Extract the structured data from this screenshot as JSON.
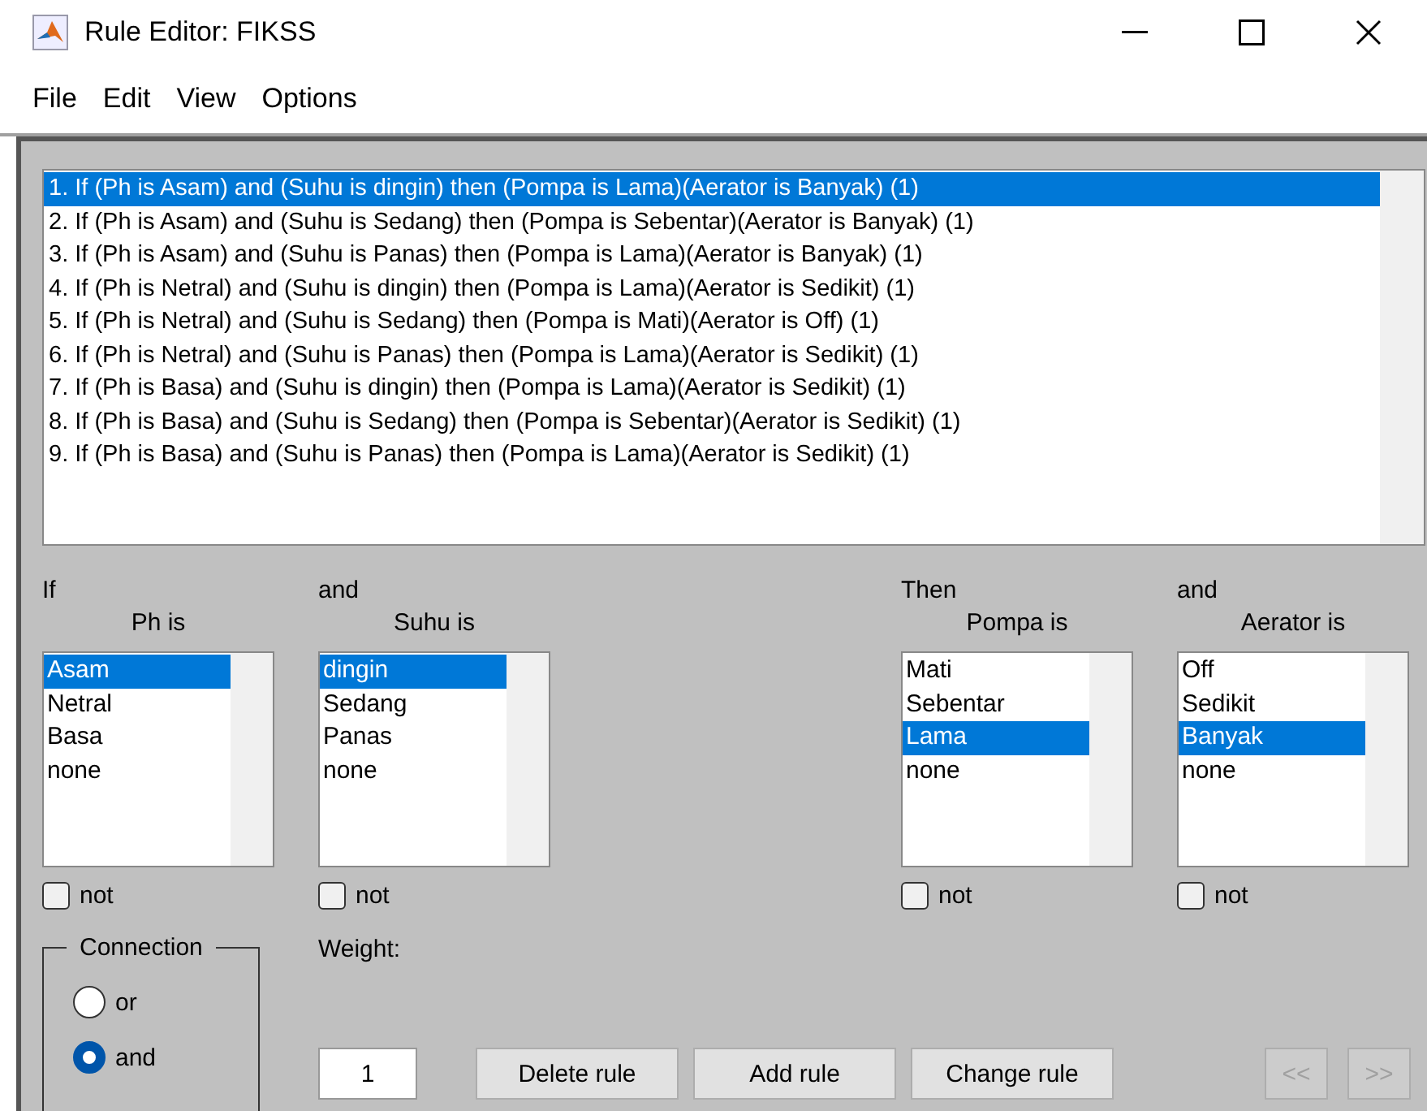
{
  "window": {
    "title": "Rule Editor: FIKSS"
  },
  "menu": [
    "File",
    "Edit",
    "View",
    "Options"
  ],
  "rules": [
    {
      "text": "1. If (Ph is Asam) and (Suhu is dingin) then (Pompa is Lama)(Aerator is Banyak) (1)",
      "selected": true
    },
    {
      "text": "2. If (Ph is Asam) and (Suhu is Sedang) then (Pompa is Sebentar)(Aerator is Banyak) (1)",
      "selected": false
    },
    {
      "text": "3. If (Ph is Asam) and (Suhu is Panas) then (Pompa is Lama)(Aerator is Banyak) (1)",
      "selected": false
    },
    {
      "text": "4. If (Ph is Netral) and (Suhu is dingin) then (Pompa is Lama)(Aerator is Sedikit) (1)",
      "selected": false
    },
    {
      "text": "5. If (Ph is Netral) and (Suhu is Sedang) then (Pompa is Mati)(Aerator is Off) (1)",
      "selected": false
    },
    {
      "text": "6. If (Ph is Netral) and (Suhu is Panas) then (Pompa is Lama)(Aerator is Sedikit) (1)",
      "selected": false
    },
    {
      "text": "7. If (Ph is Basa) and (Suhu is dingin) then (Pompa is Lama)(Aerator is Sedikit) (1)",
      "selected": false
    },
    {
      "text": "8. If (Ph is Basa) and (Suhu is Sedang) then (Pompa is Sebentar)(Aerator is Sedikit) (1)",
      "selected": false
    },
    {
      "text": "9. If (Ph is Basa) and (Suhu is Panas) then (Pompa is Lama)(Aerator is Sedikit) (1)",
      "selected": false
    }
  ],
  "columns": [
    {
      "kind": "antecedent",
      "heading": "If",
      "label": "Ph is",
      "items": [
        {
          "label": "Asam",
          "selected": true
        },
        {
          "label": "Netral",
          "selected": false
        },
        {
          "label": "Basa",
          "selected": false
        },
        {
          "label": "none",
          "selected": false
        }
      ],
      "not": {
        "label": "not",
        "checked": false
      }
    },
    {
      "kind": "antecedent",
      "heading": "and",
      "label": "Suhu is",
      "items": [
        {
          "label": "dingin",
          "selected": true
        },
        {
          "label": "Sedang",
          "selected": false
        },
        {
          "label": "Panas",
          "selected": false
        },
        {
          "label": "none",
          "selected": false
        }
      ],
      "not": {
        "label": "not",
        "checked": false
      }
    },
    {
      "kind": "consequent",
      "heading": "Then",
      "label": "Pompa is",
      "items": [
        {
          "label": "Mati",
          "selected": false
        },
        {
          "label": "Sebentar",
          "selected": false
        },
        {
          "label": "Lama",
          "selected": true
        },
        {
          "label": "none",
          "selected": false
        }
      ],
      "not": {
        "label": "not",
        "checked": false
      }
    },
    {
      "kind": "consequent",
      "heading": "and",
      "label": "Aerator is",
      "items": [
        {
          "label": "Off",
          "selected": false
        },
        {
          "label": "Sedikit",
          "selected": false
        },
        {
          "label": "Banyak",
          "selected": true
        },
        {
          "label": "none",
          "selected": false
        }
      ],
      "not": {
        "label": "not",
        "checked": false
      }
    }
  ],
  "connection": {
    "title": "Connection",
    "options": [
      {
        "label": "or",
        "selected": false
      },
      {
        "label": "and",
        "selected": true
      }
    ]
  },
  "weight": {
    "label": "Weight:",
    "value": "1"
  },
  "buttons": [
    {
      "kind": "action",
      "label": "Delete rule",
      "disabled": false
    },
    {
      "kind": "action",
      "label": "Add rule",
      "disabled": false
    },
    {
      "kind": "action",
      "label": "Change rule",
      "disabled": false
    },
    {
      "kind": "nav",
      "label": "<<",
      "disabled": true
    },
    {
      "kind": "nav",
      "label": ">>",
      "disabled": true
    }
  ]
}
